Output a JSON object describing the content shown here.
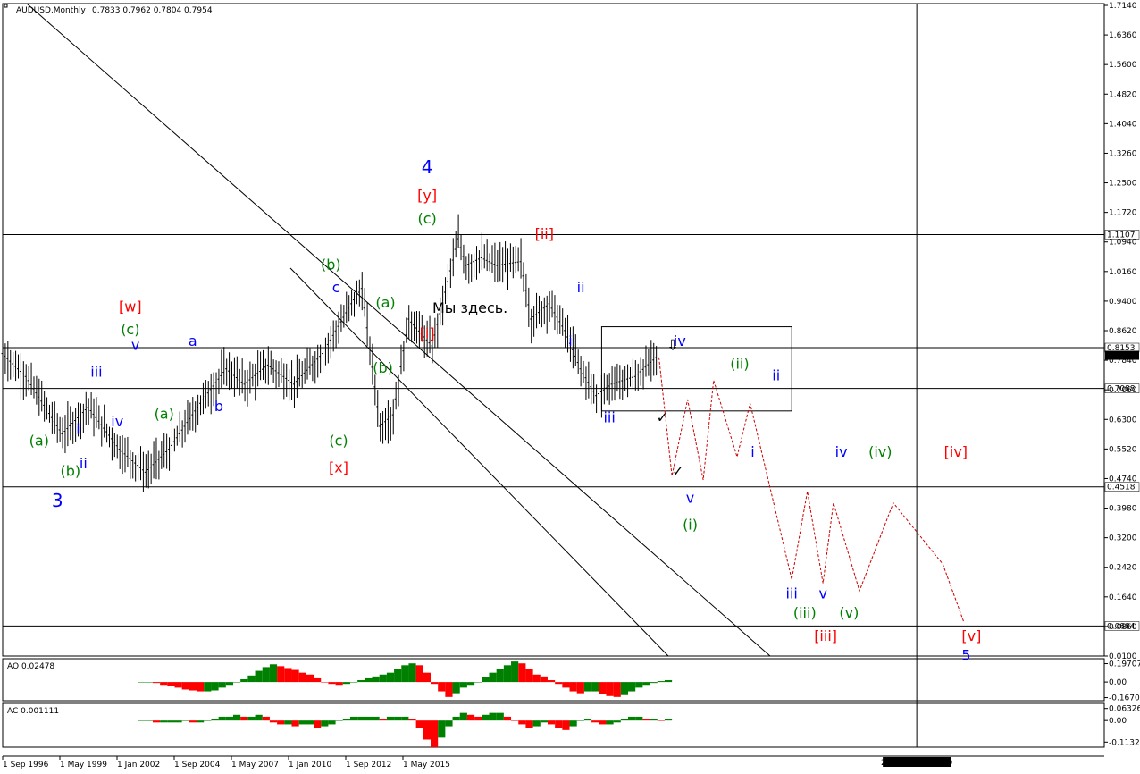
{
  "header": {
    "symbol": "AUDUSD,Monthly",
    "ohlc": "0.7833 0.7962 0.7804 0.7954",
    "ao_label": "AO 0.02478",
    "ac_label": "AC 0.001111"
  },
  "crosshair_time": "2030.02.27 00:00",
  "annotation": "Мы здесь.",
  "colors": {
    "blue": "#0000ff",
    "green": "#008000",
    "red": "#ff0000",
    "forecast": "#cc0000",
    "bar_up": "#008000",
    "bar_down": "#ff0000"
  },
  "chart_data": [
    {
      "type": "line",
      "panel": "price",
      "y_range": [
        0.01,
        1.714
      ],
      "y_ticks": [
        "1.7140",
        "1.6360",
        "1.5600",
        "1.4820",
        "1.4040",
        "1.3260",
        "1.2500",
        "1.1720",
        "1.0940",
        "1.0160",
        "0.9400",
        "0.8620",
        "0.7840",
        "0.7060",
        "0.6300",
        "0.5520",
        "0.4740",
        "0.3980",
        "0.3200",
        "0.2420",
        "0.1640",
        "0.0860",
        "0.0100"
      ],
      "x_ticks": [
        "1 Sep 1996",
        "1 May 1999",
        "1 Jan 2002",
        "1 Sep 2004",
        "1 May 2007",
        "1 Jan 2010",
        "1 Sep 2012",
        "1 May 2015"
      ],
      "x_range": [
        "1996-09",
        "2031-12"
      ],
      "price_series": {
        "x": [
          "1996-09",
          "1997-06",
          "1998-08",
          "1999-06",
          "2000-06",
          "2001-04",
          "2002-01",
          "2003-01",
          "2003-11",
          "2004-06",
          "2005-03",
          "2006-01",
          "2006-12",
          "2007-11",
          "2008-03",
          "2008-10",
          "2009-03",
          "2009-09",
          "2010-06",
          "2011-04",
          "2011-07",
          "2012-01",
          "2012-07",
          "2013-04",
          "2013-08",
          "2014-03",
          "2014-09",
          "2015-03",
          "2015-09",
          "2016-03",
          "2016-12",
          "2017-09"
        ],
        "y": [
          0.8,
          0.74,
          0.59,
          0.66,
          0.55,
          0.49,
          0.55,
          0.67,
          0.76,
          0.72,
          0.77,
          0.72,
          0.8,
          0.93,
          0.97,
          0.61,
          0.64,
          0.89,
          0.82,
          1.1,
          1.03,
          1.05,
          1.03,
          1.04,
          0.89,
          0.93,
          0.86,
          0.76,
          0.69,
          0.72,
          0.74,
          0.7954
        ]
      },
      "forecast_path": {
        "x": [
          "2017-09",
          "2018-02",
          "2018-08",
          "2019-02",
          "2019-06",
          "2020-03",
          "2020-08",
          "2021-12",
          "2022-06",
          "2022-12",
          "2023-04",
          "2024-02",
          "2025-03",
          "2026-10",
          "2027-06"
        ],
        "y": [
          0.79,
          0.48,
          0.68,
          0.47,
          0.73,
          0.53,
          0.67,
          0.21,
          0.44,
          0.2,
          0.41,
          0.18,
          0.41,
          0.25,
          0.1
        ]
      },
      "horizontal_levels": [
        {
          "value": 1.1107,
          "label": "1.1107"
        },
        {
          "value": 0.8153,
          "label": "0.8153"
        },
        {
          "value": 0.7088,
          "label": "0.7088"
        },
        {
          "value": 0.4518,
          "label": "0.4518"
        },
        {
          "value": 0.0884,
          "label": "0.0884"
        }
      ],
      "current_price": {
        "value": 0.7954,
        "label": "0.7954"
      },
      "wave_labels": [
        {
          "text": "4",
          "color": "blue",
          "x": "2010-04",
          "y": 1.27,
          "size": "big"
        },
        {
          "text": "[y]",
          "color": "red",
          "x": "2010-04",
          "y": 1.2
        },
        {
          "text": "(c)",
          "color": "green",
          "x": "2010-04",
          "y": 1.14
        },
        {
          "text": "[ii]",
          "color": "red",
          "x": "2014-01",
          "y": 1.1
        },
        {
          "text": "(b)",
          "color": "green",
          "x": "2007-03",
          "y": 1.02
        },
        {
          "text": "c",
          "color": "blue",
          "x": "2007-05",
          "y": 0.96
        },
        {
          "text": "(a)",
          "color": "green",
          "x": "2008-12",
          "y": 0.92
        },
        {
          "text": "ii",
          "color": "blue",
          "x": "2015-03",
          "y": 0.96
        },
        {
          "text": "[w]",
          "color": "red",
          "x": "2000-10",
          "y": 0.91
        },
        {
          "text": "(c)",
          "color": "green",
          "x": "2000-10",
          "y": 0.85
        },
        {
          "text": "[i]",
          "color": "red",
          "x": "2010-04",
          "y": 0.84
        },
        {
          "text": "i",
          "color": "blue",
          "x": "2014-11",
          "y": 0.82
        },
        {
          "text": "v",
          "color": "blue",
          "x": "2000-12",
          "y": 0.81
        },
        {
          "text": "a",
          "color": "blue",
          "x": "2002-10",
          "y": 0.82
        },
        {
          "text": "iv",
          "color": "blue",
          "x": "2018-05",
          "y": 0.82
        },
        {
          "text": "(ii)",
          "color": "green",
          "x": "2020-04",
          "y": 0.76
        },
        {
          "text": "iii",
          "color": "blue",
          "x": "1999-09",
          "y": 0.74
        },
        {
          "text": "(b)",
          "color": "green",
          "x": "2008-11",
          "y": 0.75
        },
        {
          "text": "ii",
          "color": "blue",
          "x": "2021-06",
          "y": 0.73
        },
        {
          "text": "b",
          "color": "blue",
          "x": "2003-08",
          "y": 0.65
        },
        {
          "text": "(a)",
          "color": "green",
          "x": "2001-11",
          "y": 0.63
        },
        {
          "text": "iv",
          "color": "blue",
          "x": "2000-05",
          "y": 0.61
        },
        {
          "text": "iii",
          "color": "blue",
          "x": "2016-02",
          "y": 0.62
        },
        {
          "text": "i",
          "color": "blue",
          "x": "1999-02",
          "y": 0.59
        },
        {
          "text": "(c)",
          "color": "green",
          "x": "2007-06",
          "y": 0.56
        },
        {
          "text": "(a)",
          "color": "green",
          "x": "1997-11",
          "y": 0.56
        },
        {
          "text": "i",
          "color": "blue",
          "x": "2020-09",
          "y": 0.53
        },
        {
          "text": "iv",
          "color": "blue",
          "x": "2023-07",
          "y": 0.53
        },
        {
          "text": "(iv)",
          "color": "green",
          "x": "2024-10",
          "y": 0.53
        },
        {
          "text": "[iv]",
          "color": "red",
          "x": "2027-03",
          "y": 0.53
        },
        {
          "text": "[x]",
          "color": "red",
          "x": "2007-06",
          "y": 0.49
        },
        {
          "text": "ii",
          "color": "blue",
          "x": "1999-04",
          "y": 0.5
        },
        {
          "text": "(b)",
          "color": "green",
          "x": "1998-11",
          "y": 0.48
        },
        {
          "text": "v",
          "color": "blue",
          "x": "2018-09",
          "y": 0.41
        },
        {
          "text": "3",
          "color": "blue",
          "x": "1998-06",
          "y": 0.4,
          "size": "big"
        },
        {
          "text": "(i)",
          "color": "green",
          "x": "2018-09",
          "y": 0.34
        },
        {
          "text": "iii",
          "color": "blue",
          "x": "2021-12",
          "y": 0.16
        },
        {
          "text": "v",
          "color": "blue",
          "x": "2022-12",
          "y": 0.16
        },
        {
          "text": "(iii)",
          "color": "green",
          "x": "2022-05",
          "y": 0.11
        },
        {
          "text": "(v)",
          "color": "green",
          "x": "2023-10",
          "y": 0.11
        },
        {
          "text": "[iii]",
          "color": "red",
          "x": "2023-01",
          "y": 0.05
        },
        {
          "text": "[v]",
          "color": "red",
          "x": "2027-09",
          "y": 0.05
        },
        {
          "text": "5",
          "color": "blue",
          "x": "2027-07",
          "y": 0.0
        }
      ]
    },
    {
      "type": "bar",
      "panel": "AO",
      "name": "AO",
      "y_ticks": [
        "0.19707",
        "0.00",
        "-0.16702"
      ],
      "y_range": [
        -0.2,
        0.25
      ],
      "x_range": [
        "2001-01",
        "2018-02"
      ],
      "values": [
        0.0,
        0.0,
        -0.01,
        -0.03,
        -0.04,
        -0.06,
        -0.08,
        -0.09,
        -0.1,
        -0.1,
        -0.09,
        -0.06,
        -0.03,
        0.0,
        0.03,
        0.07,
        0.12,
        0.16,
        0.19,
        0.17,
        0.15,
        0.13,
        0.1,
        0.08,
        0.04,
        0.0,
        -0.02,
        -0.03,
        -0.02,
        0.0,
        0.02,
        0.04,
        0.06,
        0.08,
        0.1,
        0.14,
        0.18,
        0.2,
        0.18,
        0.1,
        -0.02,
        -0.1,
        -0.16,
        -0.12,
        -0.06,
        -0.03,
        0.0,
        0.05,
        0.1,
        0.14,
        0.18,
        0.22,
        0.2,
        0.14,
        0.08,
        0.06,
        0.02,
        -0.02,
        -0.06,
        -0.1,
        -0.12,
        -0.1,
        -0.1,
        -0.13,
        -0.15,
        -0.16,
        -0.14,
        -0.1,
        -0.06,
        -0.03,
        -0.01,
        0.01,
        0.02
      ]
    },
    {
      "type": "bar",
      "panel": "AC",
      "name": "AC",
      "y_ticks": [
        "0.063264",
        "0.00",
        "-0.11325"
      ],
      "y_range": [
        -0.14,
        0.09
      ],
      "x_range": [
        "2001-01",
        "2018-02"
      ],
      "values": [
        0.0,
        0.0,
        -0.01,
        -0.01,
        -0.01,
        -0.01,
        0.0,
        -0.01,
        -0.01,
        0.0,
        0.01,
        0.02,
        0.02,
        0.03,
        0.02,
        0.02,
        0.03,
        0.02,
        -0.01,
        -0.02,
        -0.02,
        -0.03,
        -0.02,
        -0.02,
        -0.04,
        -0.03,
        -0.02,
        0.0,
        0.01,
        0.02,
        0.02,
        0.02,
        0.02,
        0.01,
        0.02,
        0.02,
        0.02,
        0.01,
        -0.04,
        -0.1,
        -0.14,
        -0.09,
        -0.03,
        0.02,
        0.04,
        0.03,
        0.02,
        0.03,
        0.04,
        0.04,
        0.02,
        0.0,
        -0.02,
        -0.04,
        -0.03,
        -0.01,
        -0.02,
        -0.04,
        -0.05,
        -0.03,
        0.0,
        0.01,
        -0.01,
        -0.02,
        -0.02,
        -0.01,
        0.01,
        0.02,
        0.02,
        0.01,
        0.01,
        0.0,
        0.01
      ]
    }
  ]
}
